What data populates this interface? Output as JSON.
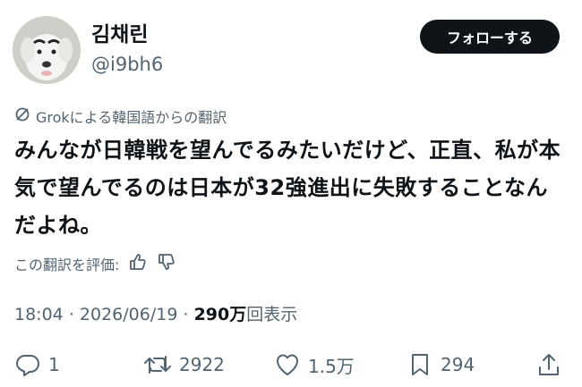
{
  "header": {
    "display_name": "김채린",
    "handle": "@i9bh6",
    "follow_label": "フォローする"
  },
  "translation": {
    "label": "Grokによる韓国語からの翻訳"
  },
  "post": {
    "text": "みんなが日韓戦を望んでるみたいだけど、正直、私が本気で望んでるのは日本が32強進出に失敗することなんだよね。"
  },
  "rating": {
    "label": "この翻訳を評価:"
  },
  "meta": {
    "time": "18:04",
    "sep1": "·",
    "date": "2026/06/19",
    "sep2": "·",
    "views_count": "290万",
    "views_label": "回表示"
  },
  "actions": {
    "replies": "1",
    "reposts": "2922",
    "likes": "1.5万",
    "bookmarks": "294"
  },
  "icons": [
    "avatar",
    "translate-icon",
    "thumbs-up-icon",
    "thumbs-down-icon",
    "reply-icon",
    "repost-icon",
    "like-icon",
    "bookmark-icon",
    "share-icon"
  ]
}
